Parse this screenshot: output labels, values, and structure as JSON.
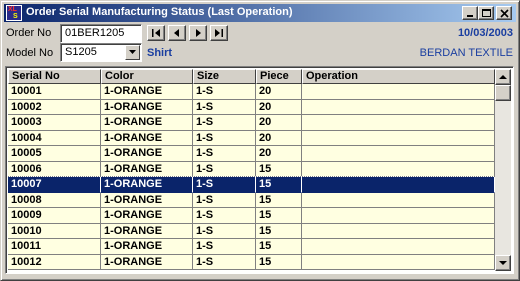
{
  "window": {
    "title": "Order Serial Manufacturing Status (Last Operation)",
    "icon_text_1": "XL",
    "icon_text_2": "S"
  },
  "form": {
    "order_label": "Order No",
    "order_value": "01BER1205",
    "model_label": "Model No",
    "model_value": "S1205",
    "model_description": "Shirt",
    "date": "10/03/2003",
    "company": "BERDAN TEXTILE"
  },
  "table": {
    "columns": [
      "Serial No",
      "Color",
      "Size",
      "Piece",
      "Operation"
    ],
    "rows": [
      [
        "10001",
        "1-ORANGE",
        "1-S",
        "20",
        ""
      ],
      [
        "10002",
        "1-ORANGE",
        "1-S",
        "20",
        ""
      ],
      [
        "10003",
        "1-ORANGE",
        "1-S",
        "20",
        ""
      ],
      [
        "10004",
        "1-ORANGE",
        "1-S",
        "20",
        ""
      ],
      [
        "10005",
        "1-ORANGE",
        "1-S",
        "20",
        ""
      ],
      [
        "10006",
        "1-ORANGE",
        "1-S",
        "15",
        ""
      ],
      [
        "10007",
        "1-ORANGE",
        "1-S",
        "15",
        ""
      ],
      [
        "10008",
        "1-ORANGE",
        "1-S",
        "15",
        ""
      ],
      [
        "10009",
        "1-ORANGE",
        "1-S",
        "15",
        ""
      ],
      [
        "10010",
        "1-ORANGE",
        "1-S",
        "15",
        ""
      ],
      [
        "10011",
        "1-ORANGE",
        "1-S",
        "15",
        ""
      ],
      [
        "10012",
        "1-ORANGE",
        "1-S",
        "15",
        ""
      ]
    ],
    "selected_serial": "10007"
  },
  "colors": {
    "title_start": "#0a246a",
    "title_end": "#a6caf0",
    "selection": "#0a246a",
    "row_background": "#ffffe1",
    "accent_text": "#1a3ea0"
  },
  "icons": [
    "app-icon",
    "minimize-icon",
    "maximize-icon",
    "close-icon",
    "first-record-icon",
    "previous-record-icon",
    "next-record-icon",
    "last-record-icon",
    "dropdown-arrow-icon",
    "scroll-up-icon",
    "scroll-down-icon"
  ]
}
